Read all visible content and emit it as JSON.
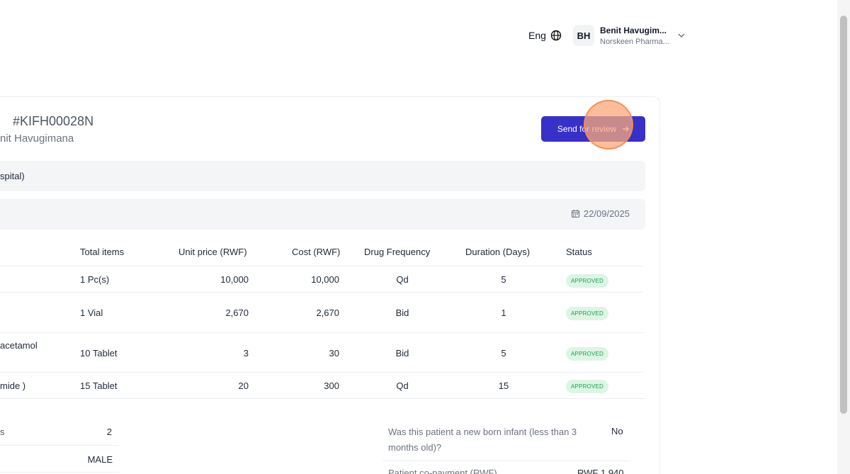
{
  "header": {
    "language": "Eng",
    "user_initials": "BH",
    "user_name": "Benit Havugim...",
    "user_org": "Norskeen Pharma..."
  },
  "invoice": {
    "code": "#KIFH00028N",
    "patient_name": "nit Havugimana",
    "send_button": "Send for review",
    "facility": "spital)",
    "date": "22/09/2025"
  },
  "table": {
    "headers": [
      "Total items",
      "Unit price (RWF)",
      "Cost (RWF)",
      "Drug Frequency",
      "Duration (Days)",
      "Status"
    ],
    "rows": [
      {
        "name": "",
        "total": "1 Pc(s)",
        "unit": "10,000",
        "cost": "10,000",
        "freq": "Qd",
        "duration": "5",
        "status": "APPROVED"
      },
      {
        "name": "",
        "total": "1 Vial",
        "unit": "2,670",
        "cost": "2,670",
        "freq": "Bid",
        "duration": "1",
        "status": "APPROVED"
      },
      {
        "name": "acetamol",
        "total": "10 Tablet",
        "unit": "3",
        "cost": "30",
        "freq": "Bid",
        "duration": "5",
        "status": "APPROVED"
      },
      {
        "name": "mide )",
        "total": "15 Tablet",
        "unit": "20",
        "cost": "300",
        "freq": "Qd",
        "duration": "15",
        "status": "APPROVED"
      }
    ]
  },
  "summary": {
    "items_label": "s",
    "items_value": "2",
    "gender_value": "MALE",
    "newborn_question": "Was this patient a new born infant (less than 3 months old)?",
    "newborn_answer": "No",
    "copay_label": "Patient co-payment (RWF)",
    "copay_value": "RWF 1,940"
  },
  "colors": {
    "primary": "#3730c9",
    "badge_bg": "#dcf5e4",
    "badge_text": "#16a34a"
  }
}
